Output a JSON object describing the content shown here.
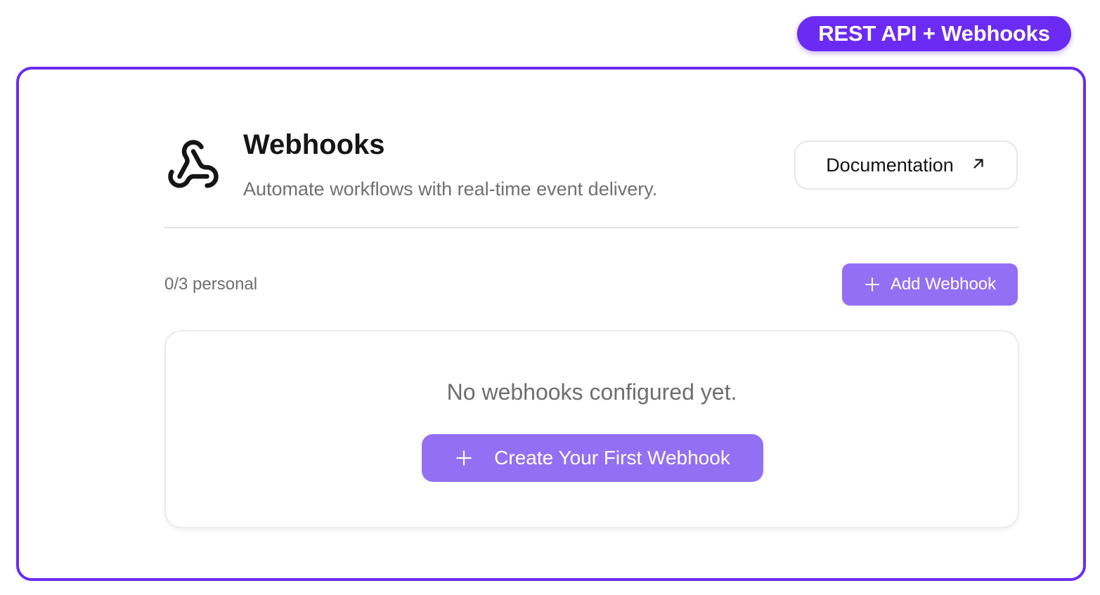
{
  "badge": {
    "label": "REST API + Webhooks"
  },
  "header": {
    "title": "Webhooks",
    "subtitle": "Automate workflows with real-time event delivery.",
    "icon": "webhook-icon",
    "documentation_label": "Documentation",
    "documentation_icon": "arrow-up-right-icon"
  },
  "toolbar": {
    "count_label": "0/3 personal",
    "add_label": "Add Webhook",
    "add_icon": "plus-icon"
  },
  "empty_state": {
    "message": "No webhooks configured yet.",
    "create_label": "Create Your First Webhook",
    "create_icon": "plus-icon"
  },
  "colors": {
    "accent": "#6b2bf2",
    "button": "#9370f3",
    "text_primary": "#151515",
    "text_muted": "#6e6e6e",
    "border": "#e7e7e7"
  }
}
